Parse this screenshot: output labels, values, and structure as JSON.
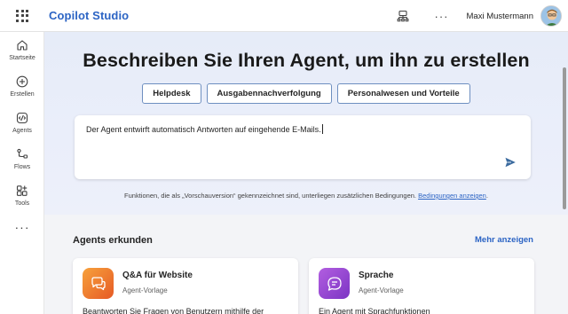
{
  "app": {
    "title": "Copilot Studio"
  },
  "header": {
    "user_name": "Maxi Mustermann",
    "more_label": "···"
  },
  "sidebar": {
    "items": [
      {
        "label": "Startseite",
        "icon": "home-icon"
      },
      {
        "label": "Erstellen",
        "icon": "plus-circle-icon"
      },
      {
        "label": "Agents",
        "icon": "agents-icon"
      },
      {
        "label": "Flows",
        "icon": "flows-icon"
      },
      {
        "label": "Tools",
        "icon": "tools-icon"
      }
    ],
    "more_label": "···"
  },
  "hero": {
    "heading": "Beschreiben Sie Ihren Agent, um ihn zu erstellen",
    "suggestions": [
      "Helpdesk",
      "Ausgabennachverfolgung",
      "Personalwesen und Vorteile"
    ],
    "prompt_value": "Der Agent entwirft automatisch Antworten auf eingehende E-Mails.",
    "disclaimer_text": "Funktionen, die als „Vorschauversion“ gekennzeichnet sind, unterliegen zusätzlichen Bedingungen.",
    "disclaimer_link": "Bedingungen anzeigen"
  },
  "explore": {
    "title": "Agents erkunden",
    "show_more": "Mehr anzeigen",
    "cards": [
      {
        "title": "Q&A für Website",
        "subtitle": "Agent-Vorlage",
        "description": "Beantworten Sie Fragen von Benutzern mithilfe der",
        "icon": "chat-question-icon",
        "color": "#ef7a2f"
      },
      {
        "title": "Sprache",
        "subtitle": "Agent-Vorlage",
        "description": "Ein Agent mit Sprachfunktionen",
        "icon": "chat-bubble-icon",
        "color": "#9b47d6"
      }
    ]
  },
  "colors": {
    "accent": "#2c64c4",
    "hero_bg": "#e6ecf8"
  }
}
